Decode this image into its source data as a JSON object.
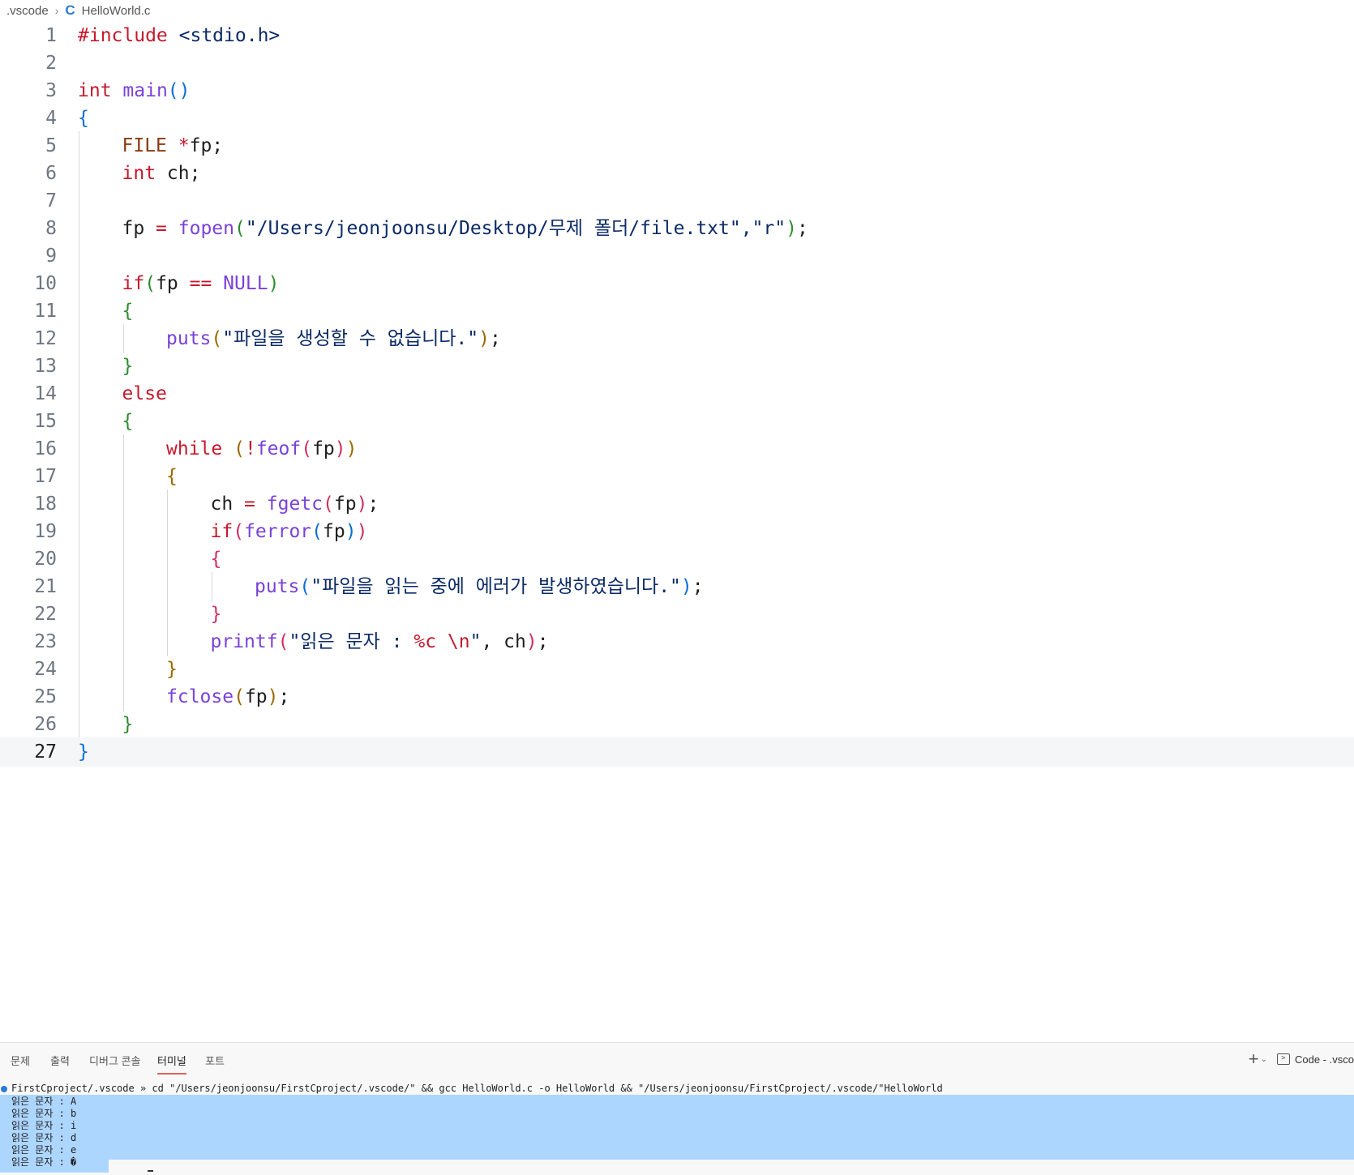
{
  "breadcrumb": {
    "folder": ".vscode",
    "file_icon": "c-language-icon",
    "file": "HelloWorld.c"
  },
  "editor": {
    "current_line": 27,
    "lines": [
      {
        "n": "1",
        "indent": 0,
        "tokens": [
          {
            "c": "kw",
            "t": "#include"
          },
          {
            "c": "txt",
            "t": " "
          },
          {
            "c": "str",
            "t": "<stdio.h>"
          }
        ]
      },
      {
        "n": "2",
        "indent": 0,
        "tokens": []
      },
      {
        "n": "3",
        "indent": 0,
        "tokens": [
          {
            "c": "kw",
            "t": "int"
          },
          {
            "c": "txt",
            "t": " "
          },
          {
            "c": "fn",
            "t": "main"
          },
          {
            "c": "p1",
            "t": "()"
          }
        ]
      },
      {
        "n": "4",
        "indent": 0,
        "tokens": [
          {
            "c": "p1",
            "t": "{"
          }
        ]
      },
      {
        "n": "5",
        "indent": 1,
        "tokens": [
          {
            "c": "type",
            "t": "FILE"
          },
          {
            "c": "txt",
            "t": " "
          },
          {
            "c": "kw",
            "t": "*"
          },
          {
            "c": "txt",
            "t": "fp;"
          }
        ]
      },
      {
        "n": "6",
        "indent": 1,
        "tokens": [
          {
            "c": "kw",
            "t": "int"
          },
          {
            "c": "txt",
            "t": " ch;"
          }
        ]
      },
      {
        "n": "7",
        "indent": 1,
        "tokens": []
      },
      {
        "n": "8",
        "indent": 1,
        "tokens": [
          {
            "c": "txt",
            "t": "fp "
          },
          {
            "c": "kw",
            "t": "="
          },
          {
            "c": "txt",
            "t": " "
          },
          {
            "c": "fn",
            "t": "fopen"
          },
          {
            "c": "p2",
            "t": "("
          },
          {
            "c": "str",
            "t": "\"/Users/jeonjoonsu/Desktop/무제 폴더/file.txt\",\"r\""
          },
          {
            "c": "p2",
            "t": ")"
          },
          {
            "c": "txt",
            "t": ";"
          }
        ]
      },
      {
        "n": "9",
        "indent": 1,
        "tokens": []
      },
      {
        "n": "10",
        "indent": 1,
        "tokens": [
          {
            "c": "kw",
            "t": "if"
          },
          {
            "c": "p2",
            "t": "("
          },
          {
            "c": "txt",
            "t": "fp "
          },
          {
            "c": "kw",
            "t": "=="
          },
          {
            "c": "txt",
            "t": " "
          },
          {
            "c": "fn",
            "t": "NULL"
          },
          {
            "c": "p2",
            "t": ")"
          }
        ]
      },
      {
        "n": "11",
        "indent": 1,
        "tokens": [
          {
            "c": "p2",
            "t": "{"
          }
        ]
      },
      {
        "n": "12",
        "indent": 2,
        "tokens": [
          {
            "c": "fn",
            "t": "puts"
          },
          {
            "c": "p3",
            "t": "("
          },
          {
            "c": "str",
            "t": "\"파일을 생성할 수 없습니다.\""
          },
          {
            "c": "p3",
            "t": ")"
          },
          {
            "c": "txt",
            "t": ";"
          }
        ]
      },
      {
        "n": "13",
        "indent": 1,
        "tokens": [
          {
            "c": "p2",
            "t": "}"
          }
        ]
      },
      {
        "n": "14",
        "indent": 1,
        "tokens": [
          {
            "c": "kw",
            "t": "else"
          }
        ]
      },
      {
        "n": "15",
        "indent": 1,
        "tokens": [
          {
            "c": "p2",
            "t": "{"
          }
        ]
      },
      {
        "n": "16",
        "indent": 2,
        "tokens": [
          {
            "c": "kw",
            "t": "while"
          },
          {
            "c": "txt",
            "t": " "
          },
          {
            "c": "p3",
            "t": "("
          },
          {
            "c": "kw",
            "t": "!"
          },
          {
            "c": "fn",
            "t": "feof"
          },
          {
            "c": "p4",
            "t": "("
          },
          {
            "c": "txt",
            "t": "fp"
          },
          {
            "c": "p4",
            "t": ")"
          },
          {
            "c": "p3",
            "t": ")"
          }
        ]
      },
      {
        "n": "17",
        "indent": 2,
        "tokens": [
          {
            "c": "p3",
            "t": "{"
          }
        ]
      },
      {
        "n": "18",
        "indent": 3,
        "tokens": [
          {
            "c": "txt",
            "t": "ch "
          },
          {
            "c": "kw",
            "t": "="
          },
          {
            "c": "txt",
            "t": " "
          },
          {
            "c": "fn",
            "t": "fgetc"
          },
          {
            "c": "p4",
            "t": "("
          },
          {
            "c": "txt",
            "t": "fp"
          },
          {
            "c": "p4",
            "t": ")"
          },
          {
            "c": "txt",
            "t": ";"
          }
        ]
      },
      {
        "n": "19",
        "indent": 3,
        "tokens": [
          {
            "c": "kw",
            "t": "if"
          },
          {
            "c": "p4",
            "t": "("
          },
          {
            "c": "fn",
            "t": "ferror"
          },
          {
            "c": "p1",
            "t": "("
          },
          {
            "c": "txt",
            "t": "fp"
          },
          {
            "c": "p1",
            "t": ")"
          },
          {
            "c": "p4",
            "t": ")"
          }
        ]
      },
      {
        "n": "20",
        "indent": 3,
        "tokens": [
          {
            "c": "p4",
            "t": "{"
          }
        ]
      },
      {
        "n": "21",
        "indent": 4,
        "tokens": [
          {
            "c": "fn",
            "t": "puts"
          },
          {
            "c": "p1",
            "t": "("
          },
          {
            "c": "str",
            "t": "\"파일을 읽는 중에 에러가 발생하였습니다.\""
          },
          {
            "c": "p1",
            "t": ")"
          },
          {
            "c": "txt",
            "t": ";"
          }
        ]
      },
      {
        "n": "22",
        "indent": 3,
        "tokens": [
          {
            "c": "p4",
            "t": "}"
          }
        ]
      },
      {
        "n": "23",
        "indent": 3,
        "tokens": [
          {
            "c": "fn",
            "t": "printf"
          },
          {
            "c": "p4",
            "t": "("
          },
          {
            "c": "str",
            "t": "\"읽은 문자 : "
          },
          {
            "c": "kw",
            "t": "%c \\n"
          },
          {
            "c": "str",
            "t": "\""
          },
          {
            "c": "txt",
            "t": ", ch"
          },
          {
            "c": "p4",
            "t": ")"
          },
          {
            "c": "txt",
            "t": ";"
          }
        ]
      },
      {
        "n": "24",
        "indent": 2,
        "tokens": [
          {
            "c": "p3",
            "t": "}"
          }
        ]
      },
      {
        "n": "25",
        "indent": 2,
        "tokens": [
          {
            "c": "fn",
            "t": "fclose"
          },
          {
            "c": "p3",
            "t": "("
          },
          {
            "c": "txt",
            "t": "fp"
          },
          {
            "c": "p3",
            "t": ")"
          },
          {
            "c": "txt",
            "t": ";"
          }
        ]
      },
      {
        "n": "26",
        "indent": 1,
        "tokens": [
          {
            "c": "p2",
            "t": "}"
          }
        ]
      },
      {
        "n": "27",
        "indent": 0,
        "tokens": [
          {
            "c": "p1",
            "t": "}"
          }
        ]
      }
    ]
  },
  "panel": {
    "tabs": [
      {
        "label": "문제",
        "name": "tab-problems",
        "active": false
      },
      {
        "label": "출력",
        "name": "tab-output",
        "active": false
      },
      {
        "label": "디버그 콘솔",
        "name": "tab-debug-console",
        "active": false
      },
      {
        "label": "터미널",
        "name": "tab-terminal",
        "active": true
      },
      {
        "label": "포트",
        "name": "tab-ports",
        "active": false
      }
    ],
    "new_terminal_icon": "plus-icon",
    "dropdown_icon": "chevron-down-icon",
    "terminal_label": "Code - .vsco",
    "terminal": {
      "command": "FirstCproject/.vscode » cd \"/Users/jeonjoonsu/FirstCproject/.vscode/\" && gcc HelloWorld.c -o HelloWorld && \"/Users/jeonjoonsu/FirstCproject/.vscode/\"HelloWorld",
      "output": [
        "읽은 문자 : A",
        "읽은 문자 : b",
        "읽은 문자 : i",
        "읽은 문자 : d",
        "읽은 문자 : e",
        "읽은 문자 : �"
      ]
    }
  }
}
